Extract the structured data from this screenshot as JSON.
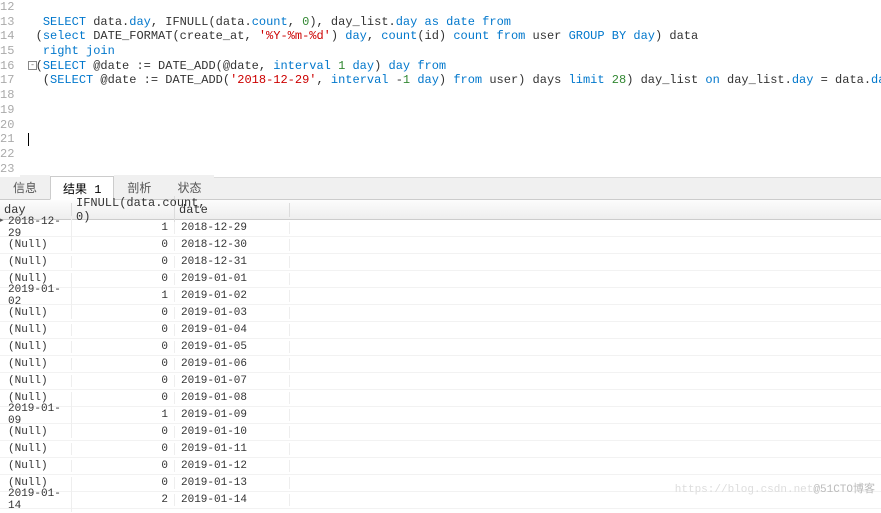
{
  "editor": {
    "first_line_no": 12,
    "code": [
      {
        "tokens": [
          {
            "t": "",
            "c": "pln"
          }
        ]
      },
      {
        "tokens": [
          {
            "t": "  ",
            "c": "pln"
          },
          {
            "t": "SELECT",
            "c": "k"
          },
          {
            "t": " data.",
            "c": "pln"
          },
          {
            "t": "day",
            "c": "k"
          },
          {
            "t": ", IFNULL(data.",
            "c": "pln"
          },
          {
            "t": "count",
            "c": "k"
          },
          {
            "t": ", ",
            "c": "pln"
          },
          {
            "t": "0",
            "c": "num"
          },
          {
            "t": "), day_list.",
            "c": "pln"
          },
          {
            "t": "day",
            "c": "k"
          },
          {
            "t": " ",
            "c": "pln"
          },
          {
            "t": "as",
            "c": "k"
          },
          {
            "t": " ",
            "c": "pln"
          },
          {
            "t": "date",
            "c": "k"
          },
          {
            "t": " ",
            "c": "pln"
          },
          {
            "t": "from",
            "c": "k"
          }
        ]
      },
      {
        "tokens": [
          {
            "t": " (",
            "c": "pln"
          },
          {
            "t": "select",
            "c": "k"
          },
          {
            "t": " DATE_FORMAT(create_at, ",
            "c": "pln"
          },
          {
            "t": "'%Y-%m-%d'",
            "c": "str"
          },
          {
            "t": ") ",
            "c": "pln"
          },
          {
            "t": "day",
            "c": "k"
          },
          {
            "t": ", ",
            "c": "pln"
          },
          {
            "t": "count",
            "c": "k"
          },
          {
            "t": "(id) ",
            "c": "pln"
          },
          {
            "t": "count",
            "c": "k"
          },
          {
            "t": " ",
            "c": "pln"
          },
          {
            "t": "from",
            "c": "k"
          },
          {
            "t": " user ",
            "c": "pln"
          },
          {
            "t": "GROUP BY",
            "c": "k"
          },
          {
            "t": " ",
            "c": "pln"
          },
          {
            "t": "day",
            "c": "k"
          },
          {
            "t": ") data",
            "c": "pln"
          }
        ]
      },
      {
        "tokens": [
          {
            "t": "  ",
            "c": "pln"
          },
          {
            "t": "right join",
            "c": "k"
          }
        ]
      },
      {
        "tokens": [
          {
            "t": " (",
            "c": "pln"
          },
          {
            "t": "SELECT",
            "c": "k"
          },
          {
            "t": " @date := DATE_ADD(@date, ",
            "c": "pln"
          },
          {
            "t": "interval",
            "c": "k"
          },
          {
            "t": " ",
            "c": "pln"
          },
          {
            "t": "1",
            "c": "num"
          },
          {
            "t": " ",
            "c": "pln"
          },
          {
            "t": "day",
            "c": "k"
          },
          {
            "t": ") ",
            "c": "pln"
          },
          {
            "t": "day",
            "c": "k"
          },
          {
            "t": " ",
            "c": "pln"
          },
          {
            "t": "from",
            "c": "k"
          }
        ]
      },
      {
        "tokens": [
          {
            "t": "  (",
            "c": "pln"
          },
          {
            "t": "SELECT",
            "c": "k"
          },
          {
            "t": " @date := DATE_ADD(",
            "c": "pln"
          },
          {
            "t": "'2018-12-29'",
            "c": "str"
          },
          {
            "t": ", ",
            "c": "pln"
          },
          {
            "t": "interval",
            "c": "k"
          },
          {
            "t": " -",
            "c": "pln"
          },
          {
            "t": "1",
            "c": "num"
          },
          {
            "t": " ",
            "c": "pln"
          },
          {
            "t": "day",
            "c": "k"
          },
          {
            "t": ") ",
            "c": "pln"
          },
          {
            "t": "from",
            "c": "k"
          },
          {
            "t": " user) days ",
            "c": "pln"
          },
          {
            "t": "limit",
            "c": "k"
          },
          {
            "t": " ",
            "c": "pln"
          },
          {
            "t": "28",
            "c": "num"
          },
          {
            "t": ") day_list ",
            "c": "pln"
          },
          {
            "t": "on",
            "c": "k"
          },
          {
            "t": " day_list.",
            "c": "pln"
          },
          {
            "t": "day",
            "c": "k"
          },
          {
            "t": " = data.",
            "c": "pln"
          },
          {
            "t": "day",
            "c": "k"
          }
        ]
      },
      {
        "tokens": [
          {
            "t": "",
            "c": "pln"
          }
        ]
      },
      {
        "tokens": [
          {
            "t": "",
            "c": "pln"
          }
        ]
      },
      {
        "tokens": [
          {
            "t": "",
            "c": "pln"
          }
        ]
      },
      {
        "tokens": [
          {
            "t": "",
            "c": "pln"
          }
        ],
        "cursor": true
      },
      {
        "tokens": [
          {
            "t": "",
            "c": "pln"
          }
        ]
      },
      {
        "tokens": [
          {
            "t": "",
            "c": "pln"
          }
        ]
      }
    ],
    "fold_at_index": 4
  },
  "tabs": {
    "items": [
      {
        "label": "信息",
        "active": false
      },
      {
        "label": "结果 1",
        "active": true
      },
      {
        "label": "剖析",
        "active": false
      },
      {
        "label": "状态",
        "active": false
      }
    ]
  },
  "grid": {
    "headers": {
      "day": "day",
      "count": "IFNULL(data.count, 0)",
      "date": "date"
    },
    "null_text": "(Null)",
    "rows": [
      {
        "day": "2018-12-29",
        "count": "1",
        "date": "2018-12-29",
        "mark": true
      },
      {
        "day": null,
        "count": "0",
        "date": "2018-12-30"
      },
      {
        "day": null,
        "count": "0",
        "date": "2018-12-31"
      },
      {
        "day": null,
        "count": "0",
        "date": "2019-01-01"
      },
      {
        "day": "2019-01-02",
        "count": "1",
        "date": "2019-01-02"
      },
      {
        "day": null,
        "count": "0",
        "date": "2019-01-03"
      },
      {
        "day": null,
        "count": "0",
        "date": "2019-01-04"
      },
      {
        "day": null,
        "count": "0",
        "date": "2019-01-05"
      },
      {
        "day": null,
        "count": "0",
        "date": "2019-01-06"
      },
      {
        "day": null,
        "count": "0",
        "date": "2019-01-07"
      },
      {
        "day": null,
        "count": "0",
        "date": "2019-01-08"
      },
      {
        "day": "2019-01-09",
        "count": "1",
        "date": "2019-01-09"
      },
      {
        "day": null,
        "count": "0",
        "date": "2019-01-10"
      },
      {
        "day": null,
        "count": "0",
        "date": "2019-01-11"
      },
      {
        "day": null,
        "count": "0",
        "date": "2019-01-12"
      },
      {
        "day": null,
        "count": "0",
        "date": "2019-01-13"
      },
      {
        "day": "2019-01-14",
        "count": "2",
        "date": "2019-01-14"
      }
    ]
  },
  "watermark": {
    "left": "https://blog.csdn.net",
    "right": "@51CTO博客"
  }
}
